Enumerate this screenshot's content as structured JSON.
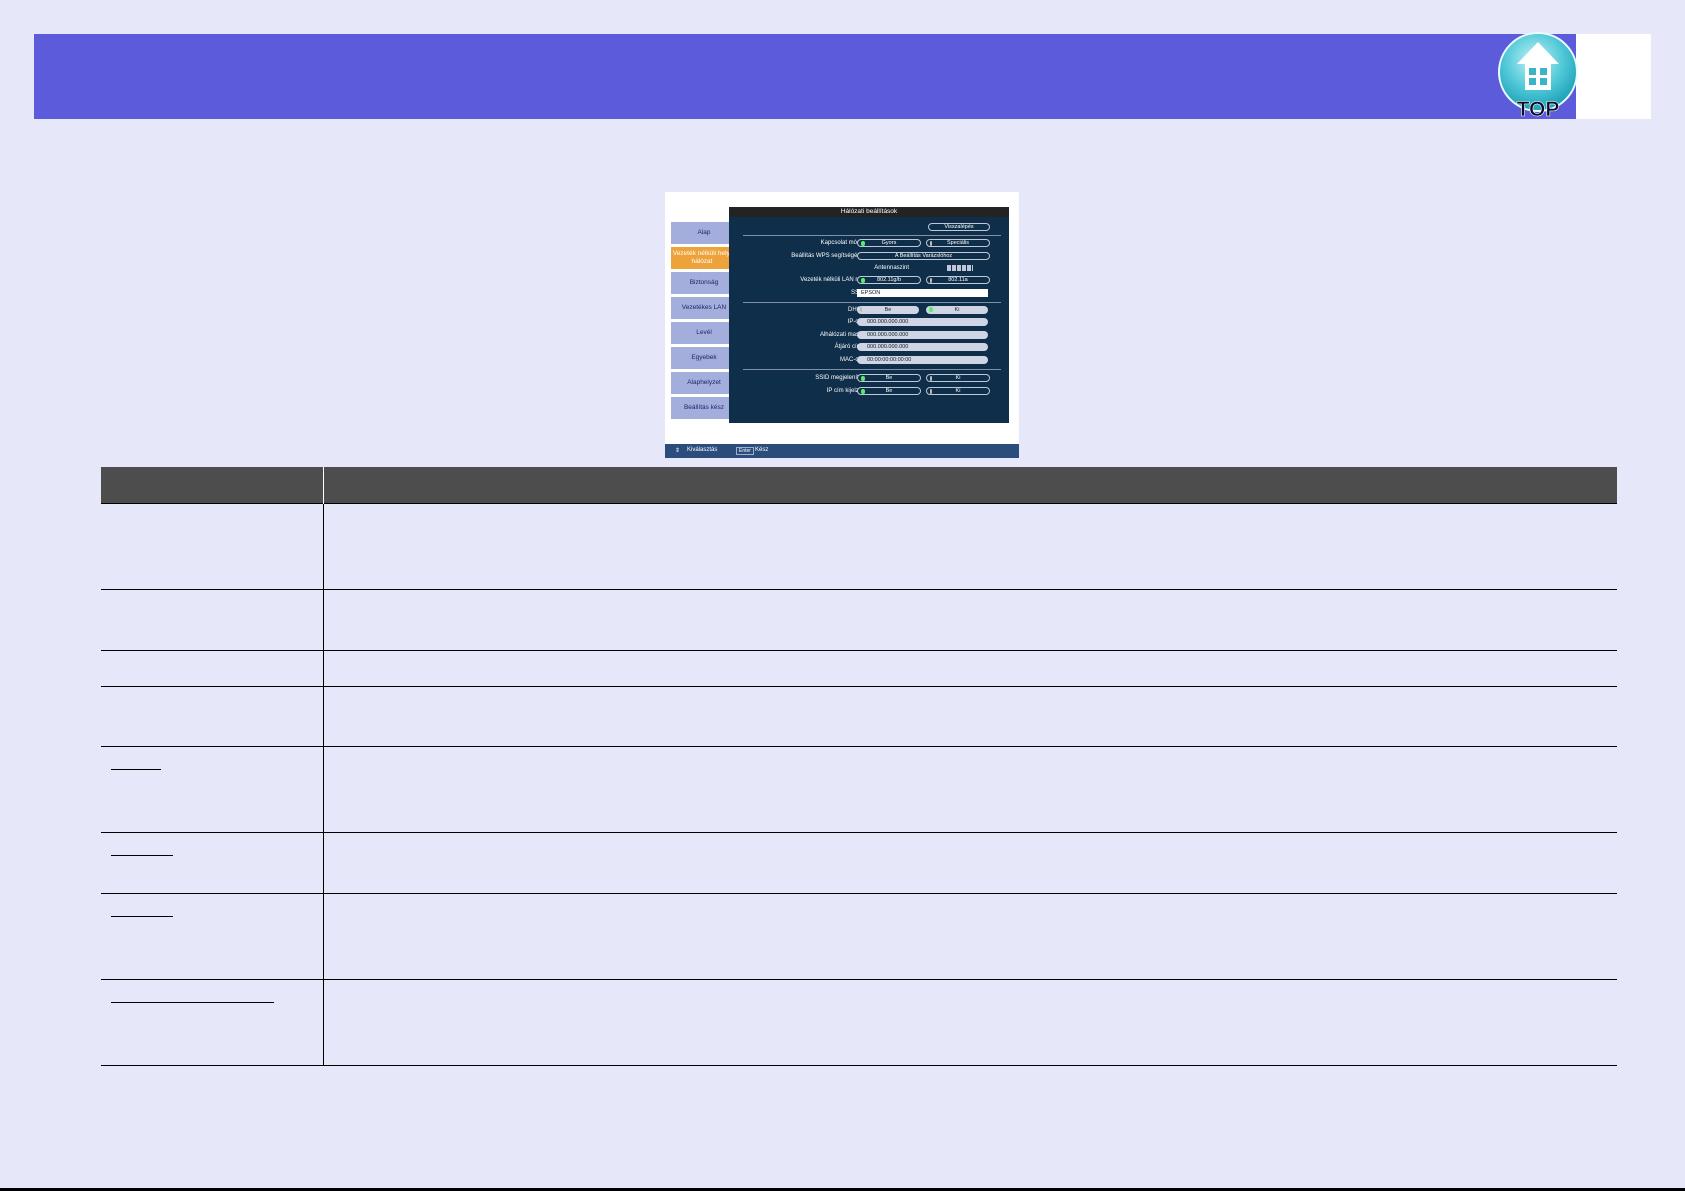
{
  "header": {
    "top_button_label": "TOP",
    "band_color": "#5b5bdc"
  },
  "menu_screenshot": {
    "tabs": [
      {
        "label": "Alap"
      },
      {
        "label": "Vezeték nélküli helyi hálózat"
      },
      {
        "label": "Biztonság"
      },
      {
        "label": "Vezetékes LAN"
      },
      {
        "label": "Levél"
      },
      {
        "label": "Egyebek"
      },
      {
        "label": "Alaphelyzet"
      },
      {
        "label": "Beállítás kész"
      }
    ],
    "panel_title": "Hálózati beállítások",
    "back_button": "Visszalépés",
    "rows": {
      "connection_mode": {
        "label": "Kapcsolat módja",
        "opt1": "Gyors",
        "opt2": "Speciális"
      },
      "wps": {
        "label": "Beállítás WPS segítségével",
        "button": "A Beállítás Varázslóhoz"
      },
      "antenna": {
        "label": "Antennaszint"
      },
      "wlan_sys": {
        "label": "Vezeték nélküli LAN rsz.",
        "opt1": "802.11g/b",
        "opt2": "802.11a"
      },
      "ssid": {
        "label": "SSID",
        "value": "EPSON"
      },
      "dhcp": {
        "label": "DHCP",
        "opt1": "Be",
        "opt2": "Ki"
      },
      "ip": {
        "label": "IP-cím",
        "value": "000.000.000.000"
      },
      "subnet": {
        "label": "Alhálózati maszk",
        "value": "000.000.000.000"
      },
      "gateway": {
        "label": "Átjáró címe",
        "value": "000.000.000.000"
      },
      "mac": {
        "label": "MAC-cím",
        "value": "00:00:00:00:00:00"
      },
      "ssid_display": {
        "label": "SSID megjelenítés",
        "opt1": "Be",
        "opt2": "Ki"
      },
      "ip_display": {
        "label": "IP cím kijelzés",
        "opt1": "Be",
        "opt2": "Ki"
      }
    },
    "status_bar": {
      "select_label": "Kiválasztás",
      "enter_key": "Enter",
      "done_label": "Kész"
    }
  }
}
